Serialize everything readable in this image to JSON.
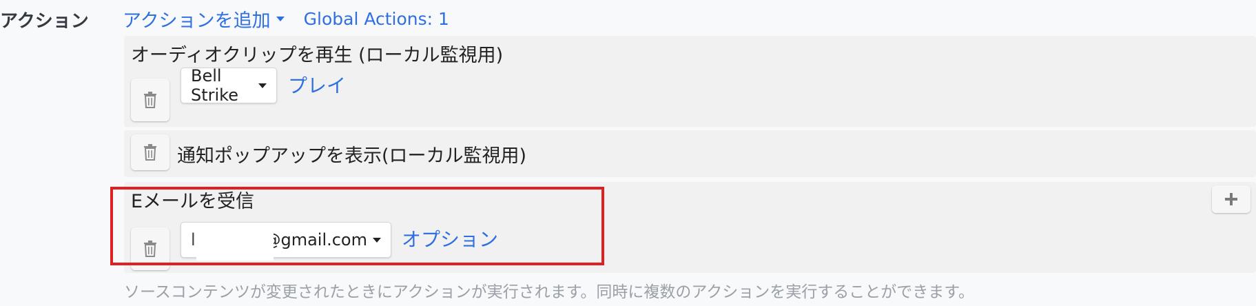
{
  "section": {
    "label": "アクション"
  },
  "header": {
    "add_action_label": "アクションを追加",
    "global_actions_label": "Global Actions: 1"
  },
  "actions": [
    {
      "title": "オーディオクリップを再生 (ローカル監視用)",
      "select_value": "Bell Strike",
      "link_label": "プレイ"
    },
    {
      "title": "通知ポップアップを表示(ローカル監視用)"
    },
    {
      "title": "Eメールを受信",
      "select_prefix": "l",
      "select_value": "@gmail.com",
      "link_label": "オプション"
    }
  ],
  "help_text": "ソースコンテンツが変更されたときにアクションが実行されます。同時に複数のアクションを実行することができます。",
  "icons": {
    "trash": "trash-icon",
    "plus": "plus-icon",
    "caret": "caret-down-icon"
  },
  "colors": {
    "link": "#2f6fe0",
    "highlight": "#e02020"
  }
}
